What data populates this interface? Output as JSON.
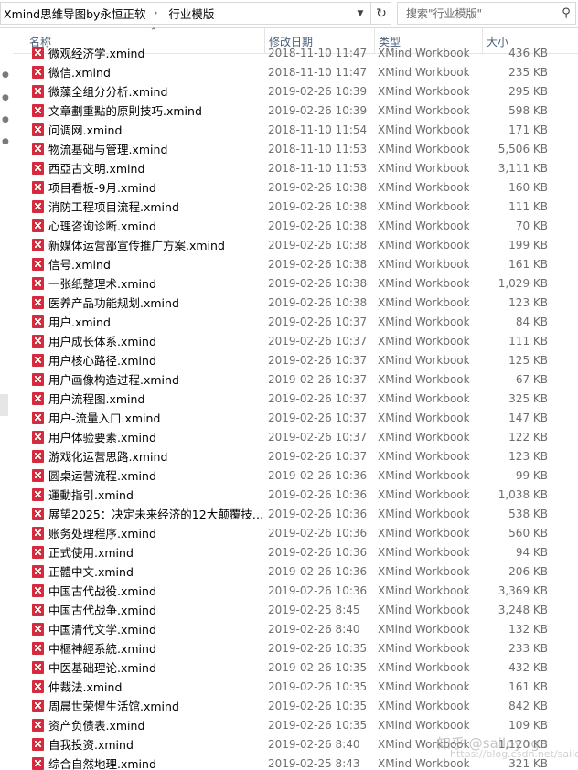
{
  "address_bar": {
    "crumbs": [
      "Xmind思维导图by永恒正软",
      "行业模版"
    ],
    "separator": "›"
  },
  "search": {
    "placeholder": "搜索\"行业模版\""
  },
  "columns": {
    "name": "名称",
    "date": "修改日期",
    "type": "类型",
    "size": "大小"
  },
  "files": [
    {
      "name": "微观经济学.xmind",
      "date": "2018-11-10 11:47",
      "type": "XMind Workbook",
      "size": "436 KB"
    },
    {
      "name": "微信.xmind",
      "date": "2018-11-10 11:47",
      "type": "XMind Workbook",
      "size": "235 KB"
    },
    {
      "name": "微藻全组分分析.xmind",
      "date": "2019-02-26 10:39",
      "type": "XMind Workbook",
      "size": "295 KB"
    },
    {
      "name": "文章劃重點的原則技巧.xmind",
      "date": "2019-02-26 10:39",
      "type": "XMind Workbook",
      "size": "598 KB"
    },
    {
      "name": "问调网.xmind",
      "date": "2018-11-10 11:54",
      "type": "XMind Workbook",
      "size": "171 KB"
    },
    {
      "name": "物流基础与管理.xmind",
      "date": "2018-11-10 11:53",
      "type": "XMind Workbook",
      "size": "5,506 KB"
    },
    {
      "name": "西亞古文明.xmind",
      "date": "2018-11-10 11:53",
      "type": "XMind Workbook",
      "size": "3,111 KB"
    },
    {
      "name": "项目看板-9月.xmind",
      "date": "2019-02-26 10:38",
      "type": "XMind Workbook",
      "size": "160 KB"
    },
    {
      "name": "消防工程项目流程.xmind",
      "date": "2019-02-26 10:38",
      "type": "XMind Workbook",
      "size": "111 KB"
    },
    {
      "name": "心理咨询诊断.xmind",
      "date": "2019-02-26 10:38",
      "type": "XMind Workbook",
      "size": "70 KB"
    },
    {
      "name": "新媒体运营部宣传推广方案.xmind",
      "date": "2019-02-26 10:38",
      "type": "XMind Workbook",
      "size": "199 KB"
    },
    {
      "name": "信号.xmind",
      "date": "2019-02-26 10:38",
      "type": "XMind Workbook",
      "size": "161 KB"
    },
    {
      "name": "一张纸整理术.xmind",
      "date": "2019-02-26 10:38",
      "type": "XMind Workbook",
      "size": "1,029 KB"
    },
    {
      "name": "医养产品功能规划.xmind",
      "date": "2019-02-26 10:38",
      "type": "XMind Workbook",
      "size": "123 KB"
    },
    {
      "name": "用户.xmind",
      "date": "2019-02-26 10:37",
      "type": "XMind Workbook",
      "size": "84 KB"
    },
    {
      "name": "用户成长体系.xmind",
      "date": "2019-02-26 10:37",
      "type": "XMind Workbook",
      "size": "111 KB"
    },
    {
      "name": "用户核心路径.xmind",
      "date": "2019-02-26 10:37",
      "type": "XMind Workbook",
      "size": "125 KB"
    },
    {
      "name": "用户画像构造过程.xmind",
      "date": "2019-02-26 10:37",
      "type": "XMind Workbook",
      "size": "67 KB"
    },
    {
      "name": "用户流程图.xmind",
      "date": "2019-02-26 10:37",
      "type": "XMind Workbook",
      "size": "325 KB"
    },
    {
      "name": "用户-流量入口.xmind",
      "date": "2019-02-26 10:37",
      "type": "XMind Workbook",
      "size": "147 KB"
    },
    {
      "name": "用户体验要素.xmind",
      "date": "2019-02-26 10:37",
      "type": "XMind Workbook",
      "size": "122 KB"
    },
    {
      "name": "游戏化运营思路.xmind",
      "date": "2019-02-26 10:37",
      "type": "XMind Workbook",
      "size": "123 KB"
    },
    {
      "name": "圆桌运营流程.xmind",
      "date": "2019-02-26 10:36",
      "type": "XMind Workbook",
      "size": "99 KB"
    },
    {
      "name": "運動指引.xmind",
      "date": "2019-02-26 10:36",
      "type": "XMind Workbook",
      "size": "1,038 KB"
    },
    {
      "name": "展望2025：决定未来经济的12大颠覆技…",
      "date": "2019-02-26 10:36",
      "type": "XMind Workbook",
      "size": "538 KB"
    },
    {
      "name": "账务处理程序.xmind",
      "date": "2019-02-26 10:36",
      "type": "XMind Workbook",
      "size": "560 KB"
    },
    {
      "name": "正式使用.xmind",
      "date": "2019-02-26 10:36",
      "type": "XMind Workbook",
      "size": "94 KB"
    },
    {
      "name": "正體中文.xmind",
      "date": "2019-02-26 10:36",
      "type": "XMind Workbook",
      "size": "206 KB"
    },
    {
      "name": "中国古代战役.xmind",
      "date": "2019-02-26 10:36",
      "type": "XMind Workbook",
      "size": "3,369 KB"
    },
    {
      "name": "中国古代战争.xmind",
      "date": "2019-02-25 8:45",
      "type": "XMind Workbook",
      "size": "3,248 KB"
    },
    {
      "name": "中国清代文学.xmind",
      "date": "2019-02-26 8:40",
      "type": "XMind Workbook",
      "size": "132 KB"
    },
    {
      "name": "中樞神經系統.xmind",
      "date": "2019-02-26 10:35",
      "type": "XMind Workbook",
      "size": "233 KB"
    },
    {
      "name": "中医基础理论.xmind",
      "date": "2019-02-26 10:35",
      "type": "XMind Workbook",
      "size": "432 KB"
    },
    {
      "name": "仲裁法.xmind",
      "date": "2019-02-26 10:35",
      "type": "XMind Workbook",
      "size": "161 KB"
    },
    {
      "name": "周晨世荣惺生活馆.xmind",
      "date": "2019-02-26 10:35",
      "type": "XMind Workbook",
      "size": "842 KB"
    },
    {
      "name": "资产负债表.xmind",
      "date": "2019-02-26 10:35",
      "type": "XMind Workbook",
      "size": "109 KB"
    },
    {
      "name": "自我投资.xmind",
      "date": "2019-02-26 8:40",
      "type": "XMind Workbook",
      "size": "1,120 KB"
    },
    {
      "name": "综合自然地理.xmind",
      "date": "2019-02-25 8:43",
      "type": "XMind Workbook",
      "size": "321 KB"
    }
  ],
  "watermark": "知乎 @sailoyoga",
  "watermark2": "https://blog.csdn.net/sailoyoga"
}
